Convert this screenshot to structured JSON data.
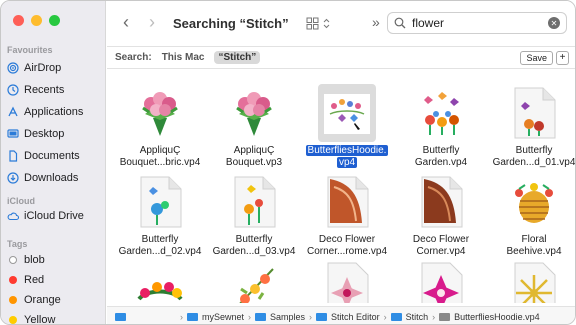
{
  "toolbar": {
    "back": "‹",
    "forward": "›",
    "title": "Searching “Stitch”",
    "search_value": "flower",
    "overflow": "»"
  },
  "scope": {
    "label": "Search:",
    "this_mac": "This Mac",
    "selected": "“Stitch”",
    "save": "Save",
    "add": "+"
  },
  "sidebar": {
    "favourites_label": "Favourites",
    "favourites": [
      {
        "label": "AirDrop",
        "icon": "airdrop-icon"
      },
      {
        "label": "Recents",
        "icon": "clock-icon"
      },
      {
        "label": "Applications",
        "icon": "applications-icon"
      },
      {
        "label": "Desktop",
        "icon": "desktop-icon"
      },
      {
        "label": "Documents",
        "icon": "document-icon"
      },
      {
        "label": "Downloads",
        "icon": "download-icon"
      }
    ],
    "icloud_label": "iCloud",
    "icloud": [
      {
        "label": "iCloud Drive",
        "icon": "cloud-icon"
      }
    ],
    "tags_label": "Tags",
    "tags": [
      {
        "label": "blob",
        "color": "#ffffff"
      },
      {
        "label": "Red",
        "color": "#ff3b30"
      },
      {
        "label": "Orange",
        "color": "#ff9500"
      },
      {
        "label": "Yellow",
        "color": "#ffcc00"
      }
    ]
  },
  "files": [
    {
      "line1": "AppliquÇ",
      "line2": "Bouquet...bric.vp4"
    },
    {
      "line1": "AppliquÇ",
      "line2": "Bouquet.vp3"
    },
    {
      "line1": "ButterfliesHoodie.",
      "line2": "vp4",
      "selected": true
    },
    {
      "line1": "Butterfly",
      "line2": "Garden.vp4"
    },
    {
      "line1": "Butterfly",
      "line2": "Garden...d_01.vp4"
    },
    {
      "line1": "Butterfly",
      "line2": "Garden...d_02.vp4"
    },
    {
      "line1": "Butterfly",
      "line2": "Garden...d_03.vp4"
    },
    {
      "line1": "Deco Flower",
      "line2": "Corner...rome.vp4"
    },
    {
      "line1": "Deco Flower",
      "line2": "Corner.vp4"
    },
    {
      "line1": "Floral",
      "line2": "Beehive.vp4"
    }
  ],
  "pathbar": [
    "mySewnet",
    "Samples",
    "Stitch Editor",
    "Stitch",
    "ButterfliesHoodie.vp4"
  ],
  "colors": {
    "accent": "#1f5fd1",
    "folder": "#2f8de4"
  }
}
